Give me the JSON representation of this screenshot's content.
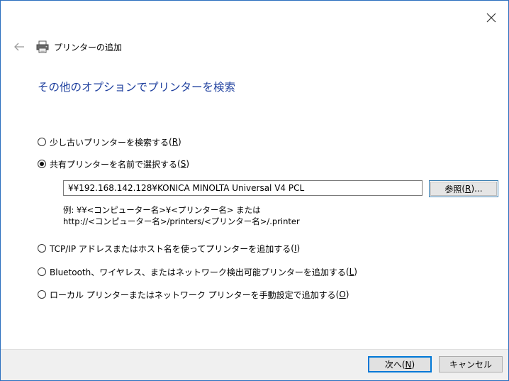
{
  "window": {
    "close_icon": "close-icon"
  },
  "nav": {
    "back_icon": "back-arrow-icon",
    "printer_icon": "printer-icon",
    "title": "プリンターの追加"
  },
  "heading": "その他のオプションでプリンターを検索",
  "options": [
    {
      "label": "少し古いプリンターを検索する",
      "access": "R",
      "checked": false
    },
    {
      "label": "共有プリンターを名前で選択する",
      "access": "S",
      "checked": true
    },
    {
      "label": "TCP/IP アドレスまたはホスト名を使ってプリンターを追加する",
      "access": "I",
      "checked": false
    },
    {
      "label": "Bluetooth、ワイヤレス、またはネットワーク検出可能プリンターを追加する",
      "access": "L",
      "checked": false
    },
    {
      "label": "ローカル プリンターまたはネットワーク プリンターを手動設定で追加する",
      "access": "O",
      "checked": false
    }
  ],
  "shared_printer": {
    "path_value": "¥¥192.168.142.128¥KONICA MINOLTA Universal V4 PCL",
    "browse_label": "参照",
    "browse_access": "R",
    "browse_suffix": "...",
    "example_line1": "例: ¥¥<コンピューター名>¥<プリンター名> または",
    "example_line2": "http://<コンピューター名>/printers/<プリンター名>/.printer"
  },
  "footer": {
    "next_label": "次へ",
    "next_access": "N",
    "cancel_label": "キャンセル"
  },
  "colors": {
    "heading": "#1e3f9e",
    "window_border": "#2b6fbf",
    "footer_bg": "#f0f0f0",
    "default_button_border": "#0078d7"
  }
}
